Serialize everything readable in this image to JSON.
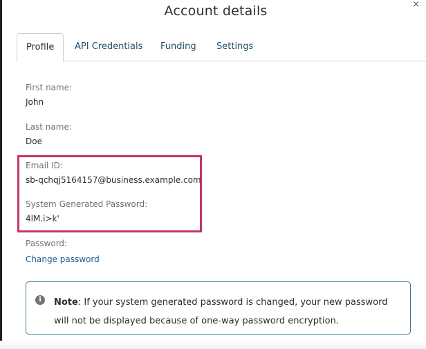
{
  "window": {
    "title": "Account details",
    "close_glyph": "×"
  },
  "tabs": [
    {
      "label": "Profile",
      "active": true
    },
    {
      "label": "API Credentials",
      "active": false
    },
    {
      "label": "Funding",
      "active": false
    },
    {
      "label": "Settings",
      "active": false
    }
  ],
  "profile": {
    "first_name_label": "First name:",
    "first_name": "John",
    "last_name_label": "Last name:",
    "last_name": "Doe",
    "email_label": "Email ID:",
    "email": "sb-qchqj5164157@business.example.com",
    "sys_password_label": "System Generated Password:",
    "sys_password": "4lM.i>k'",
    "password_label": "Password:",
    "change_password_link": "Change password"
  },
  "note": {
    "icon": "info-icon",
    "icon_glyph": "i",
    "bold_prefix": "Note",
    "text": ": If your system generated password is changed, your new password will not be displayed because of one-way password encryption."
  },
  "colors": {
    "highlight_border": "#c8336b",
    "link": "#1a5a8a",
    "note_border": "#3c7a94"
  }
}
